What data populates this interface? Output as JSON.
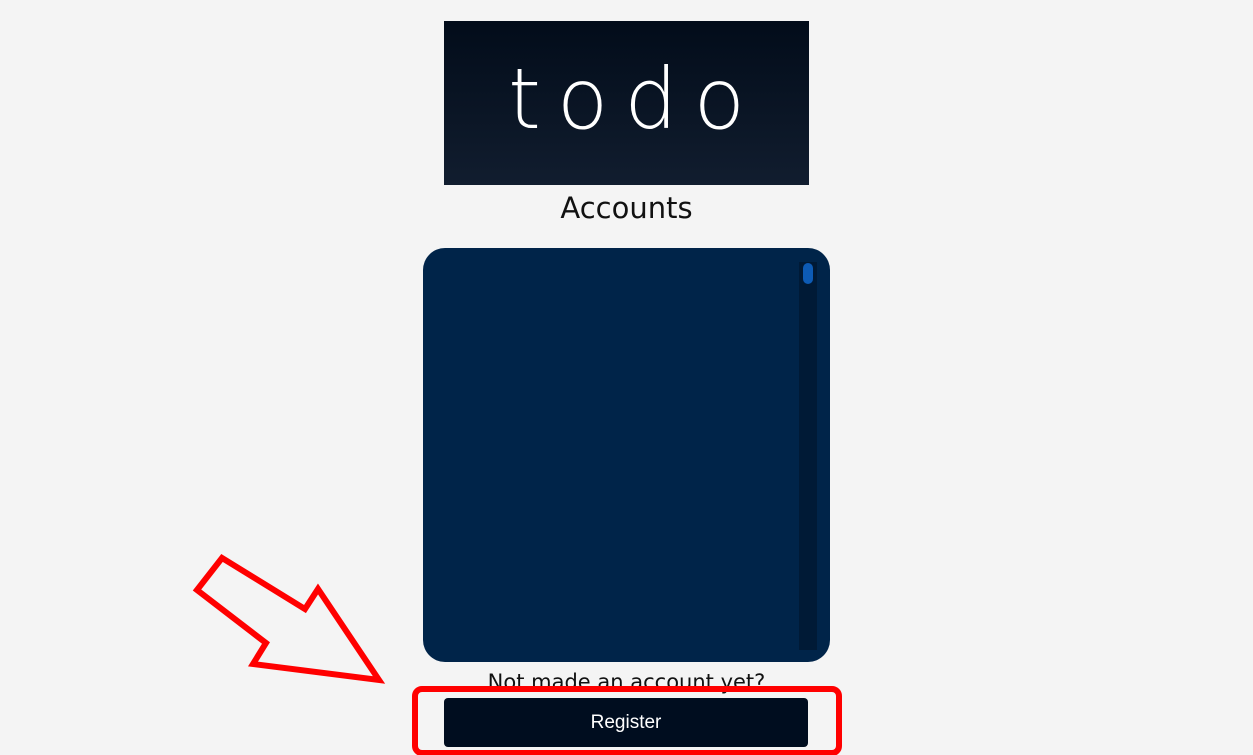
{
  "logo": {
    "text": "todo"
  },
  "accounts": {
    "title": "Accounts"
  },
  "footer": {
    "prompt": "Not made an account yet?",
    "register_label": "Register"
  },
  "annotation": {
    "color": "#ff0000",
    "icon": "arrow-icon"
  }
}
